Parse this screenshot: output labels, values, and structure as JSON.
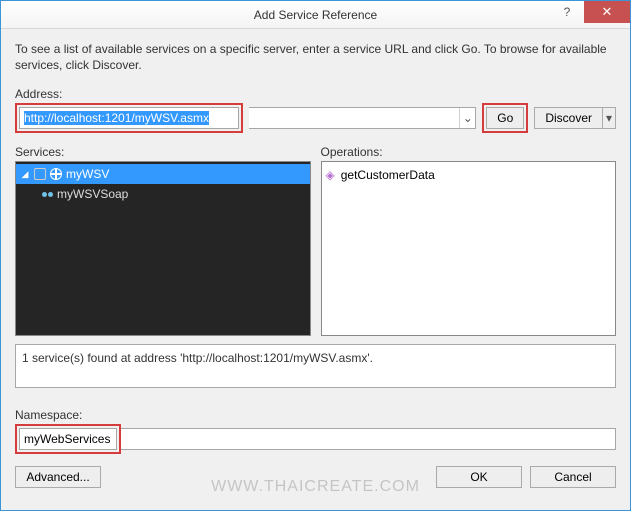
{
  "window": {
    "title": "Add Service Reference",
    "help_glyph": "?",
    "close_glyph": "✕"
  },
  "intro": "To see a list of available services on a specific server, enter a service URL and click Go. To browse for available services, click Discover.",
  "labels": {
    "address": "Address:",
    "services": "Services:",
    "operations": "Operations:",
    "namespace": "Namespace:"
  },
  "address": {
    "value": "http://localhost:1201/myWSV.asmx",
    "chevron": "⌄"
  },
  "buttons": {
    "go": "Go",
    "discover": "Discover",
    "discover_caret": "▾",
    "advanced": "Advanced...",
    "ok": "OK",
    "cancel": "Cancel"
  },
  "services_tree": {
    "root": {
      "expander": "◢",
      "label": "myWSV"
    },
    "child": {
      "label": "myWSVSoap"
    }
  },
  "operations": [
    {
      "icon": "◈",
      "label": "getCustomerData"
    }
  ],
  "status": "1 service(s) found at address 'http://localhost:1201/myWSV.asmx'.",
  "namespace": {
    "value": "myWebServices"
  },
  "watermark": "WWW.THAICREATE.COM"
}
